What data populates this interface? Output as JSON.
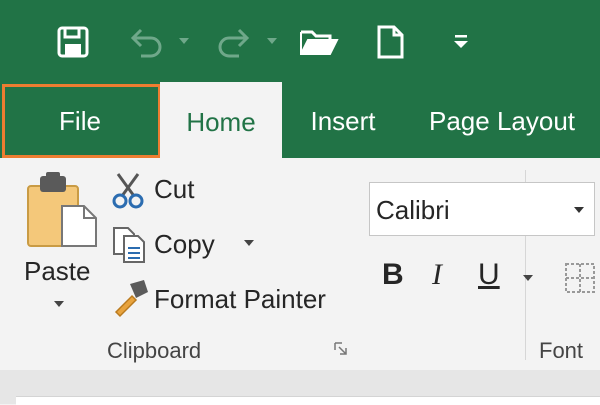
{
  "quick_access": {
    "icons": [
      "save-icon",
      "undo-icon",
      "redo-icon",
      "open-folder-icon",
      "new-document-icon",
      "customize-qat-icon"
    ]
  },
  "tabs": [
    {
      "label": "File"
    },
    {
      "label": "Home"
    },
    {
      "label": "Insert"
    },
    {
      "label": "Page Layout"
    }
  ],
  "clipboard": {
    "paste_label": "Paste",
    "cut_label": "Cut",
    "copy_label": "Copy",
    "format_painter_label": "Format Painter",
    "group_label": "Clipboard"
  },
  "font": {
    "font_name": "Calibri",
    "bold_label": "B",
    "italic_label": "I",
    "underline_label": "U",
    "group_label": "Font"
  },
  "colors": {
    "ribbon_green": "#217346",
    "highlight_orange": "#ed7d31",
    "ribbon_background": "#f3f3f3"
  }
}
